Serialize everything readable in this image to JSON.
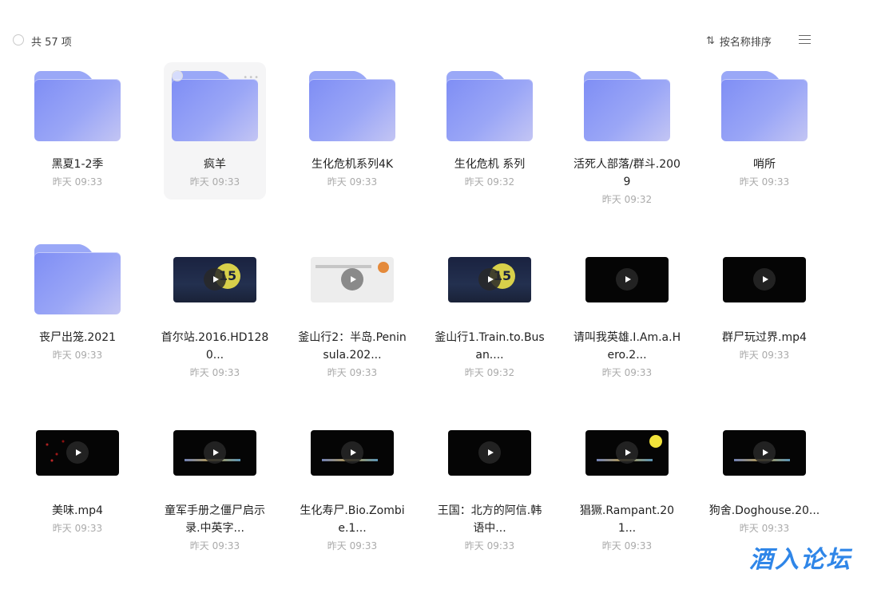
{
  "toolbar": {
    "count_label": "共 57 项",
    "sort_label": "按名称排序",
    "sort_icon": "sort-arrows-icon",
    "view_icon": "list-view-icon"
  },
  "items": [
    {
      "type": "folder",
      "name": "黑夏1-2季",
      "time": "昨天 09:33"
    },
    {
      "type": "folder",
      "name": "疯羊",
      "time": "昨天 09:33",
      "hover": true
    },
    {
      "type": "folder",
      "name": "生化危机系列4K",
      "time": "昨天 09:33"
    },
    {
      "type": "folder",
      "name": "生化危机 系列",
      "time": "昨天 09:32"
    },
    {
      "type": "folder",
      "name": "活死人部落/群斗.2009",
      "time": "昨天 09:32"
    },
    {
      "type": "folder",
      "name": "哨所",
      "time": "昨天 09:33"
    },
    {
      "type": "folder",
      "name": "丧尸出笼.2021",
      "time": "昨天 09:33"
    },
    {
      "type": "video",
      "style": "navy15",
      "name": "首尔站.2016.HD1280...",
      "time": "昨天 09:33"
    },
    {
      "type": "video",
      "style": "light",
      "name": "釜山行2：半岛.Peninsula.202...",
      "time": "昨天 09:33"
    },
    {
      "type": "video",
      "style": "navy15",
      "name": "釜山行1.Train.to.Busan....",
      "time": "昨天 09:32"
    },
    {
      "type": "video",
      "style": "black",
      "name": "请叫我英雄.I.Am.a.Hero.2...",
      "time": "昨天 09:33"
    },
    {
      "type": "video",
      "style": "black",
      "name": "群尸玩过界.mp4",
      "time": "昨天 09:33"
    },
    {
      "type": "video",
      "style": "red",
      "name": "美味.mp4",
      "time": "昨天 09:33"
    },
    {
      "type": "video",
      "style": "caption",
      "name": "童军手册之僵尸启示录.中英字...",
      "time": "昨天 09:33"
    },
    {
      "type": "video",
      "style": "caption",
      "name": "生化寿尸.Bio.Zombie.1...",
      "time": "昨天 09:33"
    },
    {
      "type": "video",
      "style": "black",
      "name": "王国：北方的阿信.韩语中...",
      "time": "昨天 09:33"
    },
    {
      "type": "video",
      "style": "yellowbadge",
      "name": "猖獗.Rampant.201...",
      "time": "昨天 09:33"
    },
    {
      "type": "video",
      "style": "caption",
      "name": "狗舍.Doghouse.20...",
      "time": "昨天 09:33"
    }
  ],
  "watermark": "酒入论坛"
}
